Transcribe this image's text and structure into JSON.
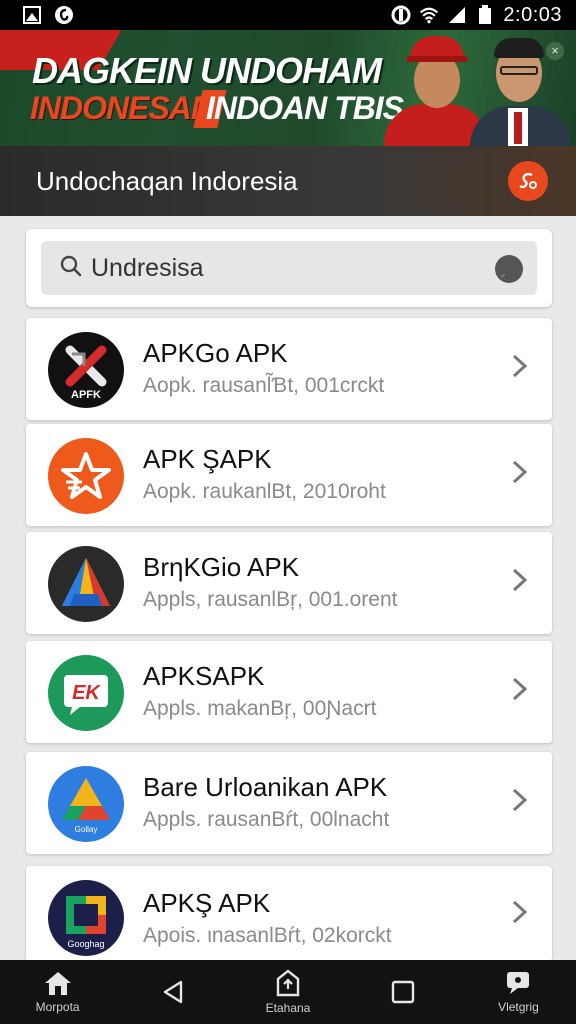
{
  "status_bar": {
    "time": "2:0:03",
    "icons": [
      "image-icon",
      "app-badge-icon",
      "sync-icon",
      "wifi-icon",
      "signal-icon",
      "battery-icon"
    ]
  },
  "banner": {
    "line1": "DAGKEIN UNDOHAM",
    "line2a": "INDONESAN",
    "line2b": "INDOAN TBIS",
    "close_icon": "close-icon"
  },
  "header": {
    "title": "Undochaqan Indoresia",
    "action_icon": "cast-icon"
  },
  "search": {
    "value": "Undresisa"
  },
  "apps": [
    {
      "title": "APKGo APK",
      "subtitle": "Aopk. rausanl̃Ɓt, 001crckt",
      "icon": "apk-x-icon",
      "icon_text": "APFK"
    },
    {
      "title": "APK ŞAPK",
      "subtitle": "Aopk. raukanlBt, 2010roht",
      "icon": "star-icon"
    },
    {
      "title": "BrηKGio APK",
      "subtitle": "Appls, rausanlBŗ, 001.orent",
      "icon": "triangle-icon"
    },
    {
      "title": "APKSAPK",
      "subtitle": "Appls. makanBŗ, 00Ɲacrt",
      "icon": "chat-icon",
      "icon_text": "EK"
    },
    {
      "title": "Bare Urloanikan APK",
      "subtitle": "Appls. rausanBŕt, 00lnacht",
      "icon": "drive-icon",
      "icon_text": "Gollay"
    },
    {
      "title": "APKŞ APK",
      "subtitle": "Apois. ιnasanlBŕt, 02korckt",
      "icon": "square-icon",
      "icon_text": "Googhag"
    }
  ],
  "nav": [
    {
      "label": "Morpota",
      "icon": "home-icon"
    },
    {
      "label": "",
      "icon": "back-icon"
    },
    {
      "label": "Etahana",
      "icon": "share-icon"
    },
    {
      "label": "",
      "icon": "recents-icon"
    },
    {
      "label": "Vletgrig",
      "icon": "chat-bubble-icon"
    }
  ],
  "colors": {
    "accent": "#e9481f",
    "banner_green": "#214f30",
    "header_bg": "#333333"
  }
}
